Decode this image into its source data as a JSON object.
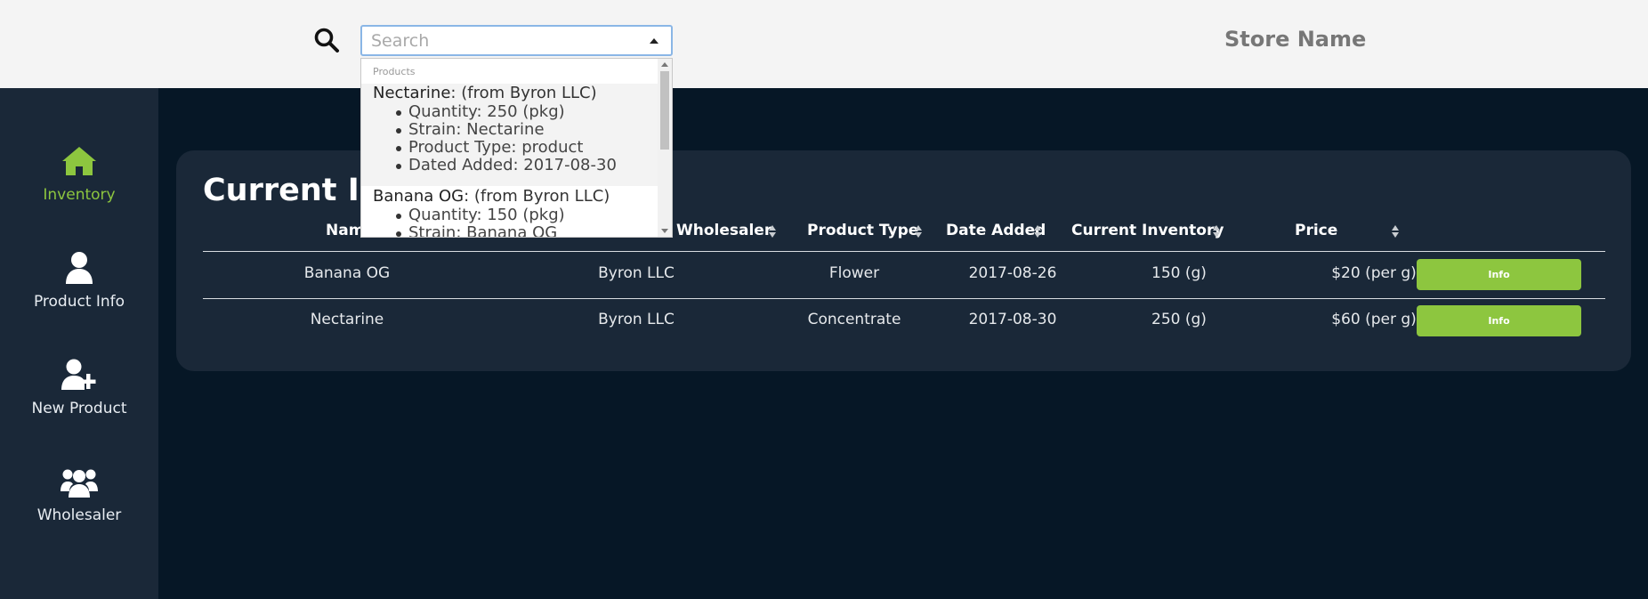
{
  "header": {
    "search_placeholder": "Search",
    "store_name": "Store Name"
  },
  "sidebar": {
    "items": [
      {
        "label": "Inventory",
        "icon": "home-icon",
        "active": true
      },
      {
        "label": "Product Info",
        "icon": "user-icon",
        "active": false
      },
      {
        "label": "New Product",
        "icon": "user-plus-icon",
        "active": false
      },
      {
        "label": "Wholesaler",
        "icon": "users-icon",
        "active": false
      }
    ]
  },
  "main": {
    "title": "Current Inventory",
    "columns": [
      "Name",
      "Wholesaler",
      "Product Type",
      "Date Added",
      "Current Inventory",
      "Price"
    ],
    "rows": [
      {
        "name": "Banana OG",
        "wholesaler": "Byron LLC",
        "type": "Flower",
        "date": "2017-08-26",
        "inventory": "150 (g)",
        "price": "$20 (per g)",
        "action": "Info"
      },
      {
        "name": "Nectarine",
        "wholesaler": "Byron LLC",
        "type": "Concentrate",
        "date": "2017-08-30",
        "inventory": "250 (g)",
        "price": "$60 (per g)",
        "action": "Info"
      }
    ]
  },
  "dropdown": {
    "group_label": "Products",
    "options": [
      {
        "name": "Nectarine",
        "source": ": (from Byron LLC)",
        "details": [
          "Quantity: 250 (pkg)",
          "Strain: Nectarine",
          "Product Type: product",
          "Dated Added: 2017-08-30"
        ]
      },
      {
        "name": "Banana OG",
        "source": ": (from Byron LLC)",
        "details": [
          "Quantity: 150 (pkg)",
          "Strain: Banana OG"
        ]
      }
    ]
  },
  "colors": {
    "accent": "#8dc63f",
    "background": "#061726",
    "panel": "#1a2838",
    "topbar": "#f4f4f4"
  }
}
